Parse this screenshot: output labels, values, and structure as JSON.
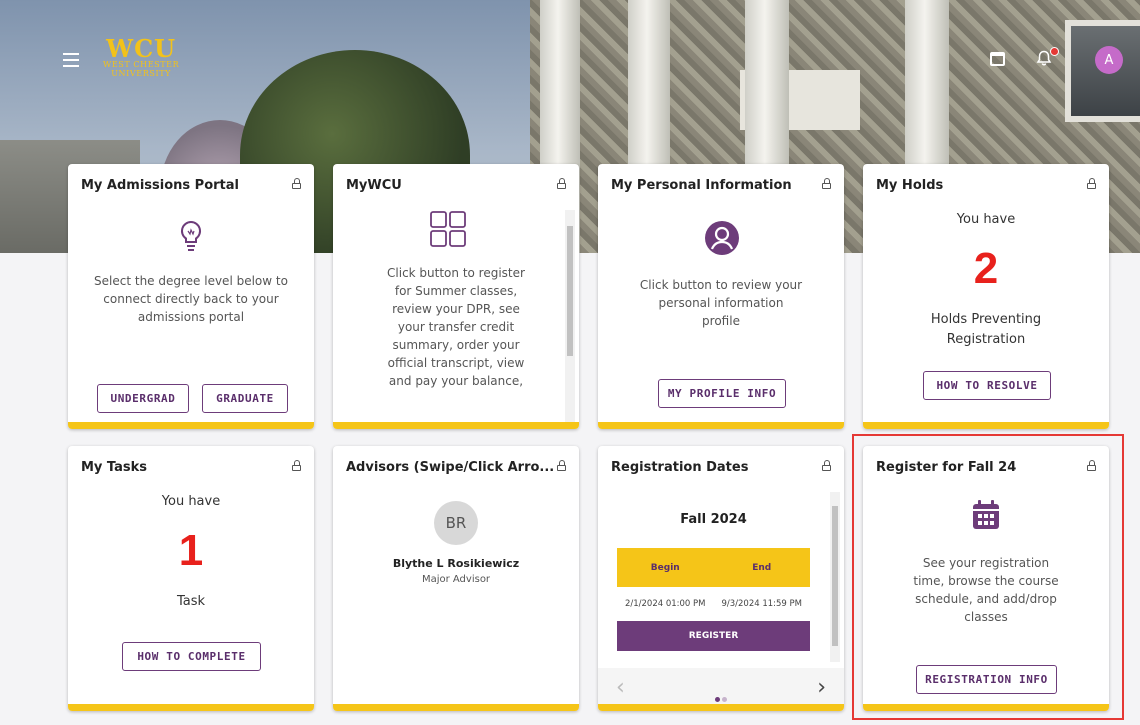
{
  "header": {
    "logo_main": "WCU",
    "logo_sub1": "WEST CHESTER",
    "logo_sub2": "UNIVERSITY",
    "avatar_initial": "A"
  },
  "colors": {
    "brand_purple": "#6d3c7a",
    "accent_gold": "#f5c518",
    "alert_red": "#e8211c",
    "highlight_red": "#e53935"
  },
  "cards": {
    "admissions": {
      "title": "My Admissions Portal",
      "desc": "Select the degree level below to connect directly back to your admissions portal",
      "btn_undergrad": "UNDERGRAD",
      "btn_graduate": "GRADUATE",
      "icon": "lightbulb-icon"
    },
    "mywcu": {
      "title": "MyWCU",
      "desc": "Click button to register for Summer classes, review your DPR, see your transfer credit summary, order your official transcript, view and pay your balance,",
      "icon": "grid-icon"
    },
    "personal": {
      "title": "My Personal Information",
      "desc": "Click button to review your personal information profile",
      "btn": "MY PROFILE INFO",
      "icon": "user-circle-icon"
    },
    "holds": {
      "title": "My Holds",
      "you_have": "You have",
      "count": "2",
      "label": "Holds Preventing Registration",
      "btn": "HOW TO RESOLVE"
    },
    "tasks": {
      "title": "My Tasks",
      "you_have": "You have",
      "count": "1",
      "label": "Task",
      "btn": "HOW TO COMPLETE"
    },
    "advisors": {
      "title": "Advisors (Swipe/Click Arro...",
      "initials": "BR",
      "name": "Blythe L Rosikiewicz",
      "role": "Major Advisor"
    },
    "regdates": {
      "title": "Registration Dates",
      "term": "Fall 2024",
      "col_begin": "Begin",
      "col_end": "End",
      "begin": "2/1/2024 01:00 PM",
      "end": "9/3/2024 11:59 PM",
      "btn": "REGISTER"
    },
    "regfall": {
      "title": "Register for Fall 24",
      "desc": "See your registration time, browse the course schedule, and add/drop classes",
      "btn": "REGISTRATION INFO",
      "icon": "calendar-icon"
    }
  }
}
